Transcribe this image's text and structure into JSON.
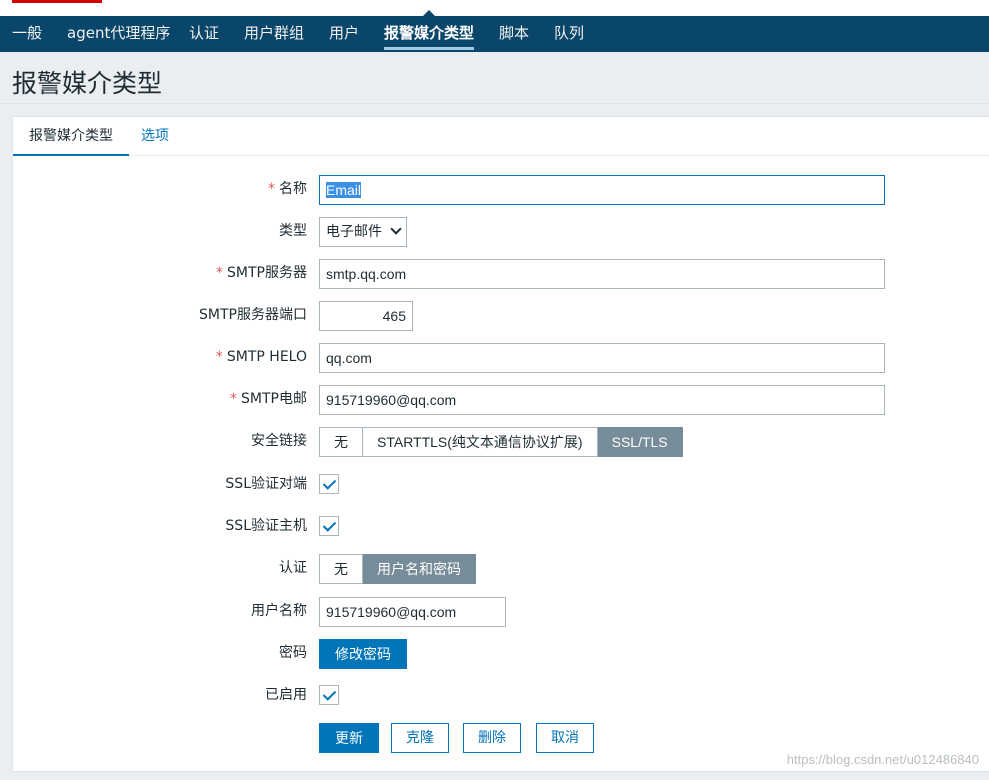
{
  "nav": {
    "items": [
      "一般",
      "agent代理程序",
      "认证",
      "用户群组",
      "用户",
      "报警媒介类型",
      "脚本",
      "队列"
    ],
    "active": "报警媒介类型"
  },
  "page_title": "报警媒介类型",
  "tabs": [
    "报警媒介类型",
    "选项"
  ],
  "form": {
    "name": {
      "label": "名称",
      "value": "Email"
    },
    "type": {
      "label": "类型",
      "value": "电子邮件"
    },
    "smtp_server": {
      "label": "SMTP服务器",
      "value": "smtp.qq.com"
    },
    "smtp_port": {
      "label": "SMTP服务器端口",
      "value": "465"
    },
    "smtp_helo": {
      "label": "SMTP HELO",
      "value": "qq.com"
    },
    "smtp_email": {
      "label": "SMTP电邮",
      "value": "915719960@qq.com"
    },
    "security": {
      "label": "安全链接",
      "options": [
        "无",
        "STARTTLS(纯文本通信协议扩展)",
        "SSL/TLS"
      ],
      "selected": "SSL/TLS"
    },
    "ssl_verify_peer": {
      "label": "SSL验证对端",
      "checked": true
    },
    "ssl_verify_host": {
      "label": "SSL验证主机",
      "checked": true
    },
    "auth": {
      "label": "认证",
      "options": [
        "无",
        "用户名和密码"
      ],
      "selected": "用户名和密码"
    },
    "username": {
      "label": "用户名称",
      "value": "915719960@qq.com"
    },
    "password": {
      "label": "密码",
      "button": "修改密码"
    },
    "enabled": {
      "label": "已启用",
      "checked": true
    },
    "required_mark": "*"
  },
  "actions": {
    "update": "更新",
    "clone": "克隆",
    "delete": "删除",
    "cancel": "取消"
  },
  "watermark": "https://blog.csdn.net/u012486840",
  "colors": {
    "nav_bg": "#0a466a",
    "primary": "#0275b8",
    "segment_on": "#768d99",
    "required": "#e45959"
  }
}
